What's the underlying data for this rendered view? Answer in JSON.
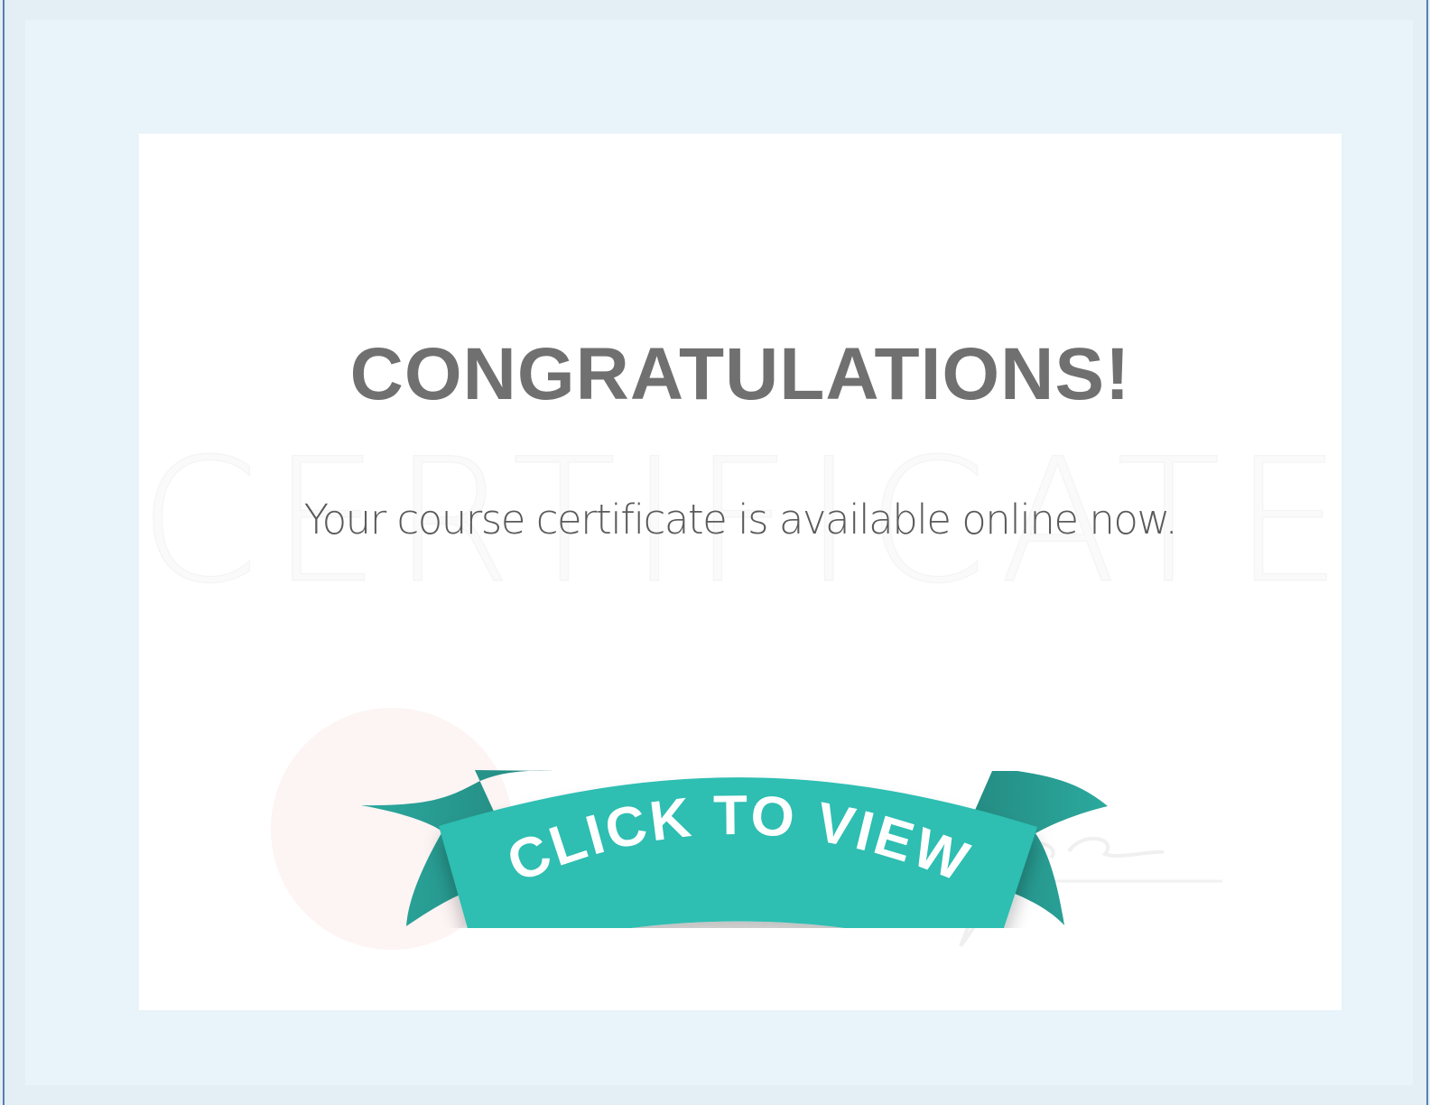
{
  "headline": "CONGRATULATIONS!",
  "subtext": "Your course certificate is available online now.",
  "watermark": "CERTIFICATE",
  "button": {
    "label": "CLICK TO VIEW"
  },
  "colors": {
    "ribbon": "#2ebeb2",
    "ribbon_dark": "#2a9f96",
    "ribbon_fold": "#1a7a6e",
    "headline": "#707070",
    "card": "#ffffff",
    "frame": "#e8f3fa"
  }
}
